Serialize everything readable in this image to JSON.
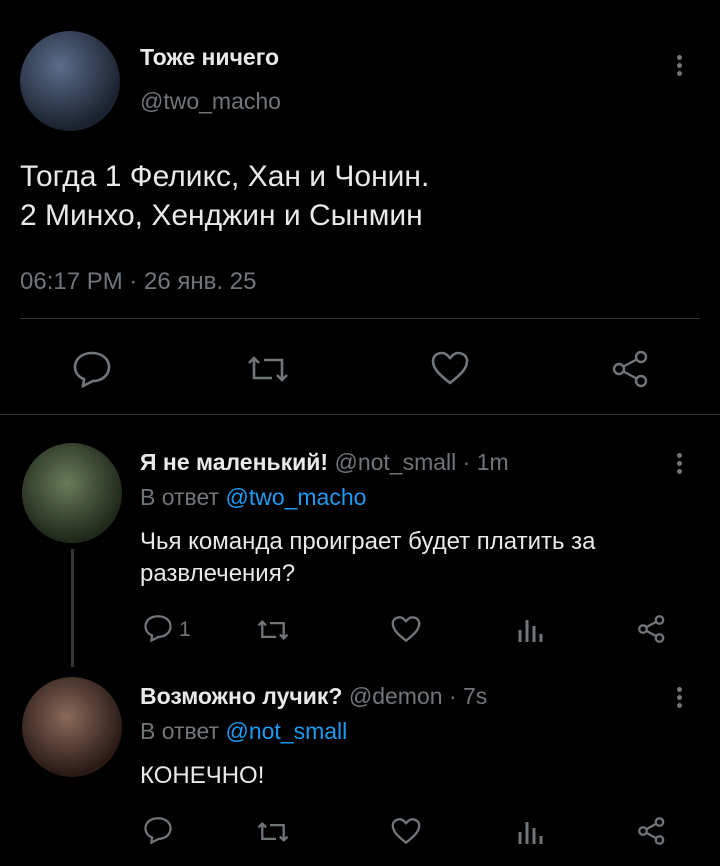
{
  "main_tweet": {
    "display_name": "Тоже ничего",
    "handle": "@two_macho",
    "text_line1": "Тогда 1 Феликс, Хан и Чонин.",
    "text_line2": "2 Минхо, Хенджин и Сынмин",
    "timestamp": "06:17 PM · 26 янв. 25"
  },
  "replies": [
    {
      "display_name": "Я не маленький!",
      "handle": "@not_small",
      "time": "· 1m",
      "reply_to_prefix": "В ответ",
      "reply_to_handle": "@two_macho",
      "text_line1": "Чья команда проиграет будет платить за",
      "text_line2": "развлечения?",
      "reply_count": "1"
    },
    {
      "display_name": "Возможно лучик?",
      "handle": "@demon",
      "time": "· 7s",
      "reply_to_prefix": "В ответ",
      "reply_to_handle": "@not_small",
      "text_line1": "КОНЕЧНО!"
    }
  ],
  "icons": {
    "reply": "comment-icon",
    "retweet": "retweet-icon",
    "like": "heart-icon",
    "share": "share-icon",
    "views": "views-icon",
    "more": "more-vertical-icon"
  },
  "colors": {
    "background": "#000000",
    "text": "#e7e9ea",
    "secondary": "#71767b",
    "link": "#1d9bf0"
  }
}
